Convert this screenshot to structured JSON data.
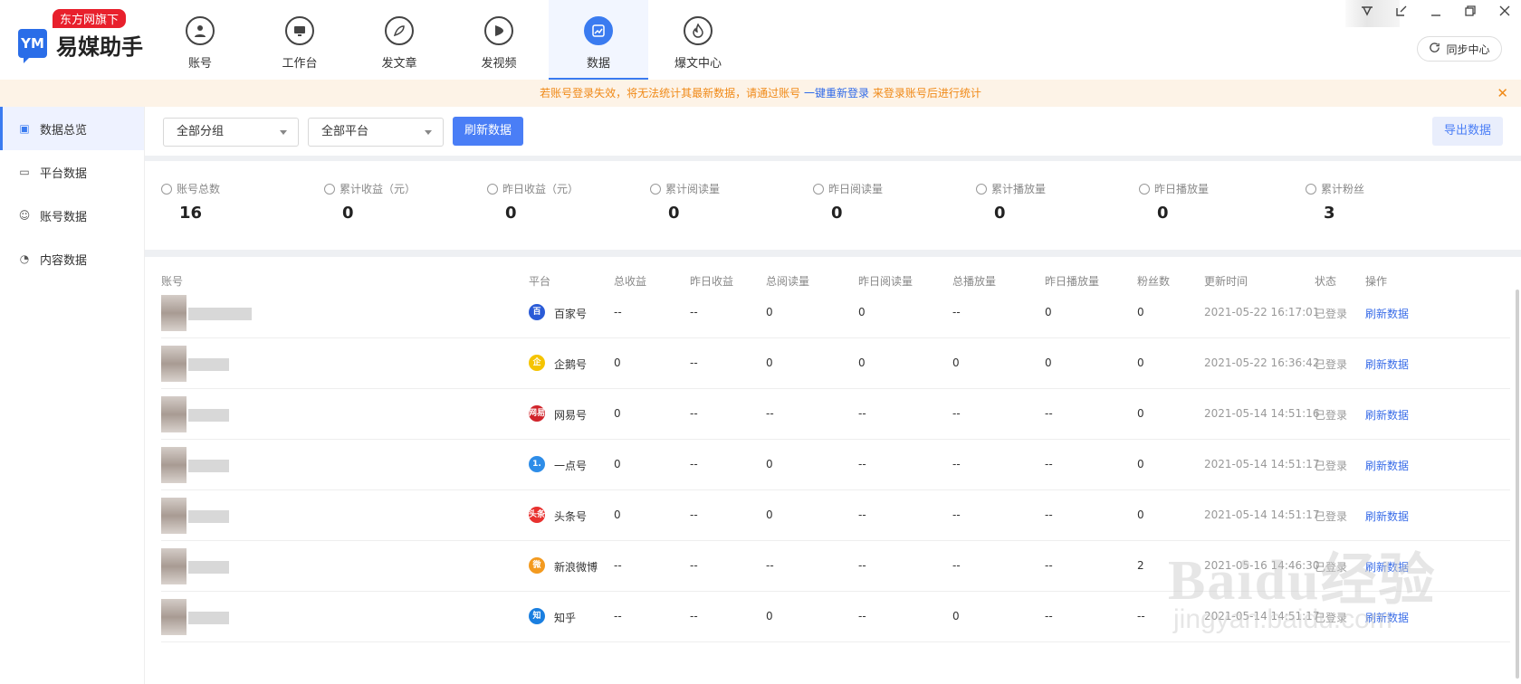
{
  "logo": {
    "badge": "东方网旗下",
    "mark": "YM",
    "name": "易媒助手"
  },
  "nav": [
    {
      "label": "账号",
      "icon": "user-icon",
      "active": false
    },
    {
      "label": "工作台",
      "icon": "monitor-icon",
      "active": false
    },
    {
      "label": "发文章",
      "icon": "feather-icon",
      "active": false
    },
    {
      "label": "发视频",
      "icon": "play-icon",
      "active": false
    },
    {
      "label": "数据",
      "icon": "chart-icon",
      "active": true
    },
    {
      "label": "爆文中心",
      "icon": "fire-icon",
      "active": false
    }
  ],
  "sync_label": "同步中心",
  "notice": {
    "before": "若账号登录失效，将无法统计其最新数据，请通过账号 ",
    "link": "一键重新登录",
    "after": " 来登录账号后进行统计"
  },
  "sidebar": [
    {
      "label": "数据总览",
      "icon": "chart-icon",
      "active": true
    },
    {
      "label": "平台数据",
      "icon": "monitor-icon",
      "active": false
    },
    {
      "label": "账号数据",
      "icon": "user-icon",
      "active": false
    },
    {
      "label": "内容数据",
      "icon": "pie-icon",
      "active": false
    }
  ],
  "filters": {
    "group": "全部分组",
    "platform": "全部平台",
    "refresh": "刷新数据",
    "export": "导出数据"
  },
  "stats": [
    {
      "label": "账号总数",
      "value": "16",
      "icon": "user-icon"
    },
    {
      "label": "累计收益（元）",
      "value": "0",
      "icon": "wallet-icon"
    },
    {
      "label": "昨日收益（元）",
      "value": "0",
      "icon": "yen-icon"
    },
    {
      "label": "累计阅读量",
      "value": "0",
      "icon": "doc-icon"
    },
    {
      "label": "昨日阅读量",
      "value": "0",
      "icon": "eye-icon"
    },
    {
      "label": "累计播放量",
      "value": "0",
      "icon": "check-circle-icon"
    },
    {
      "label": "昨日播放量",
      "value": "0",
      "icon": "play-circle-icon"
    },
    {
      "label": "累计粉丝",
      "value": "3",
      "icon": "fans-icon"
    }
  ],
  "table": {
    "headers": [
      "账号",
      "平台",
      "总收益",
      "昨日收益",
      "总阅读量",
      "昨日阅读量",
      "总播放量",
      "昨日播放量",
      "粉丝数",
      "更新时间",
      "状态",
      "操作"
    ],
    "rows": [
      {
        "platform": "百家号",
        "icon": "baijiahao-icon",
        "color": "#2a5bd7",
        "glyph": "百",
        "total_income": "--",
        "yesterday_income": "--",
        "total_reads": "0",
        "yesterday_reads": "0",
        "total_plays": "--",
        "yesterday_plays": "0",
        "fans": "0",
        "updated": "2021-05-22 16:17:01",
        "status": "已登录",
        "action": "刷新数据"
      },
      {
        "platform": "企鹅号",
        "icon": "qie-icon",
        "color": "#f5c400",
        "glyph": "企",
        "total_income": "0",
        "yesterday_income": "--",
        "total_reads": "0",
        "yesterday_reads": "0",
        "total_plays": "0",
        "yesterday_plays": "0",
        "fans": "0",
        "updated": "2021-05-22 16:36:42",
        "status": "已登录",
        "action": "刷新数据"
      },
      {
        "platform": "网易号",
        "icon": "wangyi-icon",
        "color": "#d0242b",
        "glyph": "网易",
        "total_income": "0",
        "yesterday_income": "--",
        "total_reads": "--",
        "yesterday_reads": "--",
        "total_plays": "--",
        "yesterday_plays": "--",
        "fans": "0",
        "updated": "2021-05-14 14:51:16",
        "status": "已登录",
        "action": "刷新数据"
      },
      {
        "platform": "一点号",
        "icon": "yidian-icon",
        "color": "#2e8de8",
        "glyph": "1.",
        "total_income": "0",
        "yesterday_income": "--",
        "total_reads": "0",
        "yesterday_reads": "--",
        "total_plays": "--",
        "yesterday_plays": "--",
        "fans": "0",
        "updated": "2021-05-14 14:51:17",
        "status": "已登录",
        "action": "刷新数据"
      },
      {
        "platform": "头条号",
        "icon": "toutiao-icon",
        "color": "#e8312f",
        "glyph": "头条",
        "total_income": "0",
        "yesterday_income": "--",
        "total_reads": "0",
        "yesterday_reads": "--",
        "total_plays": "--",
        "yesterday_plays": "--",
        "fans": "0",
        "updated": "2021-05-14 14:51:17",
        "status": "已登录",
        "action": "刷新数据"
      },
      {
        "platform": "新浪微博",
        "icon": "weibo-icon",
        "color": "#f39a1f",
        "glyph": "微",
        "total_income": "--",
        "yesterday_income": "--",
        "total_reads": "--",
        "yesterday_reads": "--",
        "total_plays": "--",
        "yesterday_plays": "--",
        "fans": "2",
        "updated": "2021-05-16 14:46:30",
        "status": "已登录",
        "action": "刷新数据"
      },
      {
        "platform": "知乎",
        "icon": "zhihu-icon",
        "color": "#1a7fe0",
        "glyph": "知",
        "total_income": "--",
        "yesterday_income": "--",
        "total_reads": "0",
        "yesterday_reads": "--",
        "total_plays": "0",
        "yesterday_plays": "--",
        "fans": "--",
        "updated": "2021-05-14 14:51:17",
        "status": "已登录",
        "action": "刷新数据"
      }
    ]
  },
  "watermark": {
    "main": "Baidu经验",
    "sub": "jingyan.baidu.com"
  }
}
